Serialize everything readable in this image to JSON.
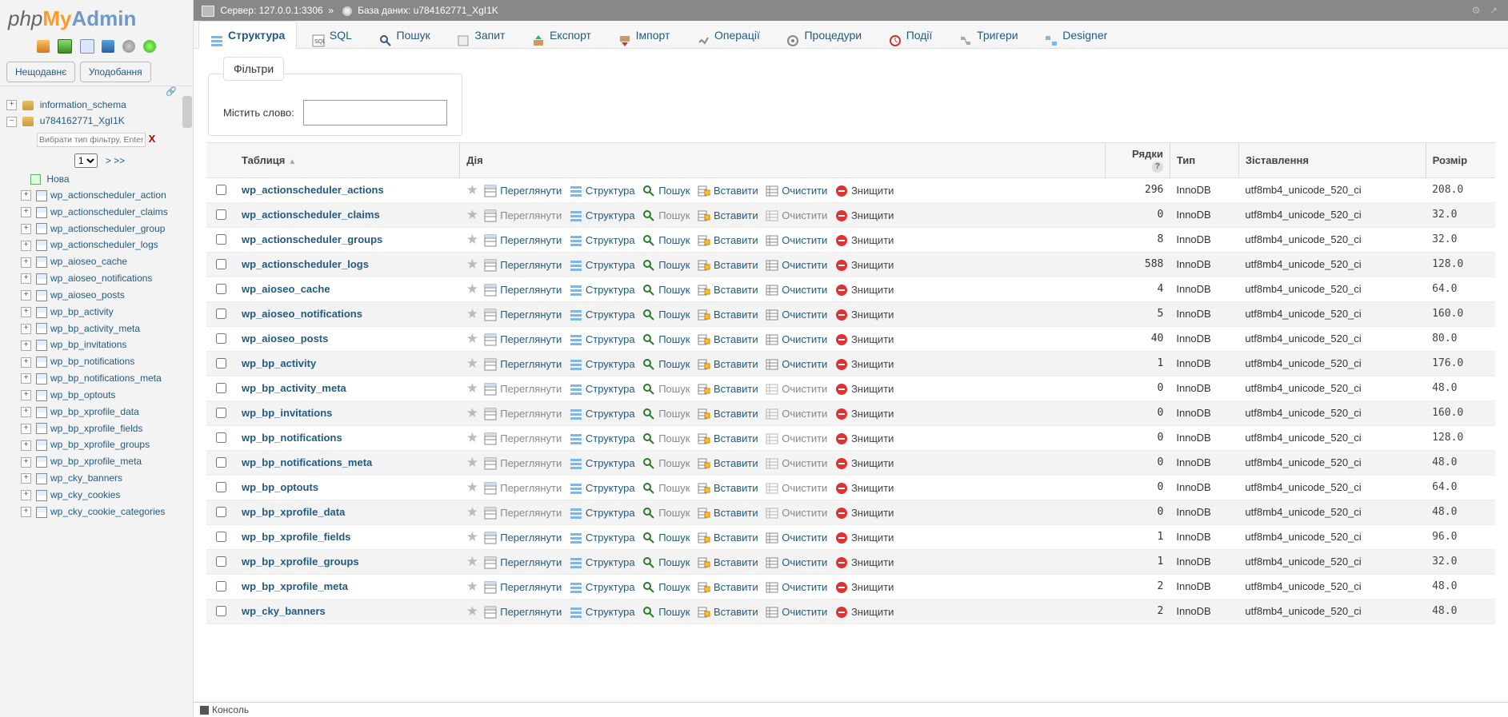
{
  "logo": {
    "p1": "php",
    "p2": "My",
    "p3": "Admin"
  },
  "fav_tabs": {
    "recent": "Нещодавнє",
    "favorites": "Уподобання"
  },
  "nav_dbs": [
    "information_schema",
    "u784162771_XgI1K"
  ],
  "nav_filter_placeholder": "Вибрати тип фільтру, Enter u",
  "nav_filter_x": "X",
  "nav_pager": {
    "page": "1",
    "next": "> >>"
  },
  "nav_new": "Нова",
  "nav_tables": [
    "wp_actionscheduler_action",
    "wp_actionscheduler_claims",
    "wp_actionscheduler_group",
    "wp_actionscheduler_logs",
    "wp_aioseo_cache",
    "wp_aioseo_notifications",
    "wp_aioseo_posts",
    "wp_bp_activity",
    "wp_bp_activity_meta",
    "wp_bp_invitations",
    "wp_bp_notifications",
    "wp_bp_notifications_meta",
    "wp_bp_optouts",
    "wp_bp_xprofile_data",
    "wp_bp_xprofile_fields",
    "wp_bp_xprofile_groups",
    "wp_bp_xprofile_meta",
    "wp_cky_banners",
    "wp_cky_cookies",
    "wp_cky_cookie_categories"
  ],
  "crumbs": {
    "server_label": "Сервер:",
    "server": "127.0.0.1:3306",
    "db_label": "База даних:",
    "db": "u784162771_XgI1K",
    "sep": "»"
  },
  "tabs": {
    "structure": "Структура",
    "sql": "SQL",
    "search": "Пошук",
    "query": "Запит",
    "export": "Експорт",
    "import": "Імпорт",
    "operations": "Операції",
    "routines": "Процедури",
    "events": "Події",
    "triggers": "Тригери",
    "designer": "Designer"
  },
  "filters": {
    "legend": "Фільтри",
    "label": "Містить слово:"
  },
  "headers": {
    "table": "Таблиця",
    "action": "Дія",
    "rows": "Рядки",
    "type": "Тип",
    "collation": "Зіставлення",
    "size": "Розмір"
  },
  "actions": {
    "browse": "Переглянути",
    "structure": "Структура",
    "search": "Пошук",
    "insert": "Вставити",
    "empty": "Очистити",
    "drop": "Знищити"
  },
  "rows": [
    {
      "name": "wp_actionscheduler_actions",
      "rows": 296,
      "type": "InnoDB",
      "coll": "utf8mb4_unicode_520_ci",
      "size": "208.0",
      "dim": false
    },
    {
      "name": "wp_actionscheduler_claims",
      "rows": 0,
      "type": "InnoDB",
      "coll": "utf8mb4_unicode_520_ci",
      "size": "32.0",
      "dim": true
    },
    {
      "name": "wp_actionscheduler_groups",
      "rows": 8,
      "type": "InnoDB",
      "coll": "utf8mb4_unicode_520_ci",
      "size": "32.0",
      "dim": false
    },
    {
      "name": "wp_actionscheduler_logs",
      "rows": 588,
      "type": "InnoDB",
      "coll": "utf8mb4_unicode_520_ci",
      "size": "128.0",
      "dim": false
    },
    {
      "name": "wp_aioseo_cache",
      "rows": 4,
      "type": "InnoDB",
      "coll": "utf8mb4_unicode_520_ci",
      "size": "64.0",
      "dim": false
    },
    {
      "name": "wp_aioseo_notifications",
      "rows": 5,
      "type": "InnoDB",
      "coll": "utf8mb4_unicode_520_ci",
      "size": "160.0",
      "dim": false
    },
    {
      "name": "wp_aioseo_posts",
      "rows": 40,
      "type": "InnoDB",
      "coll": "utf8mb4_unicode_520_ci",
      "size": "80.0",
      "dim": false
    },
    {
      "name": "wp_bp_activity",
      "rows": 1,
      "type": "InnoDB",
      "coll": "utf8mb4_unicode_520_ci",
      "size": "176.0",
      "dim": false
    },
    {
      "name": "wp_bp_activity_meta",
      "rows": 0,
      "type": "InnoDB",
      "coll": "utf8mb4_unicode_520_ci",
      "size": "48.0",
      "dim": true
    },
    {
      "name": "wp_bp_invitations",
      "rows": 0,
      "type": "InnoDB",
      "coll": "utf8mb4_unicode_520_ci",
      "size": "160.0",
      "dim": true
    },
    {
      "name": "wp_bp_notifications",
      "rows": 0,
      "type": "InnoDB",
      "coll": "utf8mb4_unicode_520_ci",
      "size": "128.0",
      "dim": true
    },
    {
      "name": "wp_bp_notifications_meta",
      "rows": 0,
      "type": "InnoDB",
      "coll": "utf8mb4_unicode_520_ci",
      "size": "48.0",
      "dim": true
    },
    {
      "name": "wp_bp_optouts",
      "rows": 0,
      "type": "InnoDB",
      "coll": "utf8mb4_unicode_520_ci",
      "size": "64.0",
      "dim": true
    },
    {
      "name": "wp_bp_xprofile_data",
      "rows": 0,
      "type": "InnoDB",
      "coll": "utf8mb4_unicode_520_ci",
      "size": "48.0",
      "dim": true
    },
    {
      "name": "wp_bp_xprofile_fields",
      "rows": 1,
      "type": "InnoDB",
      "coll": "utf8mb4_unicode_520_ci",
      "size": "96.0",
      "dim": false
    },
    {
      "name": "wp_bp_xprofile_groups",
      "rows": 1,
      "type": "InnoDB",
      "coll": "utf8mb4_unicode_520_ci",
      "size": "32.0",
      "dim": false
    },
    {
      "name": "wp_bp_xprofile_meta",
      "rows": 2,
      "type": "InnoDB",
      "coll": "utf8mb4_unicode_520_ci",
      "size": "48.0",
      "dim": false
    },
    {
      "name": "wp_cky_banners",
      "rows": 2,
      "type": "InnoDB",
      "coll": "utf8mb4_unicode_520_ci",
      "size": "48.0",
      "dim": false
    }
  ],
  "console": "Консоль"
}
